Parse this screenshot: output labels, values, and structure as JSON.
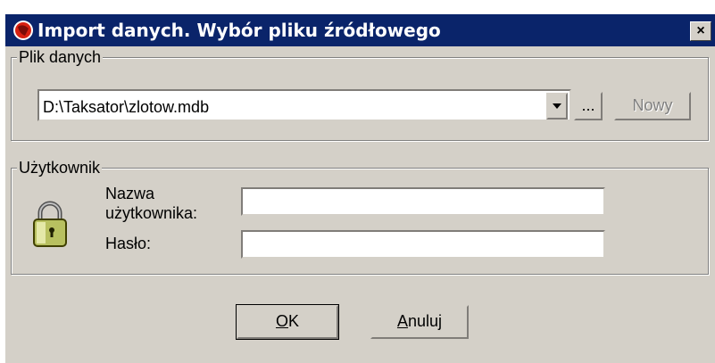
{
  "window": {
    "title": "Import danych. Wybór pliku źródłowego",
    "close_glyph": "×"
  },
  "data_file_group": {
    "label": "Plik danych",
    "path_value": "D:\\Taksator\\zlotow.mdb",
    "browse_label": "...",
    "new_label": "Nowy"
  },
  "user_group": {
    "label": "Użytkownik",
    "username_label_line1": "Nazwa",
    "username_label_line2": "użytkownika:",
    "password_label": "Hasło:",
    "username_value": "",
    "password_value": "",
    "icon": "padlock-icon"
  },
  "buttons": {
    "ok_label": "OK",
    "ok_mnemonic": "O",
    "cancel_label": "Anuluj",
    "cancel_mnemonic": "A"
  },
  "colors": {
    "titlebar": "#0a246a",
    "dialog_face": "#d4d0c8"
  }
}
